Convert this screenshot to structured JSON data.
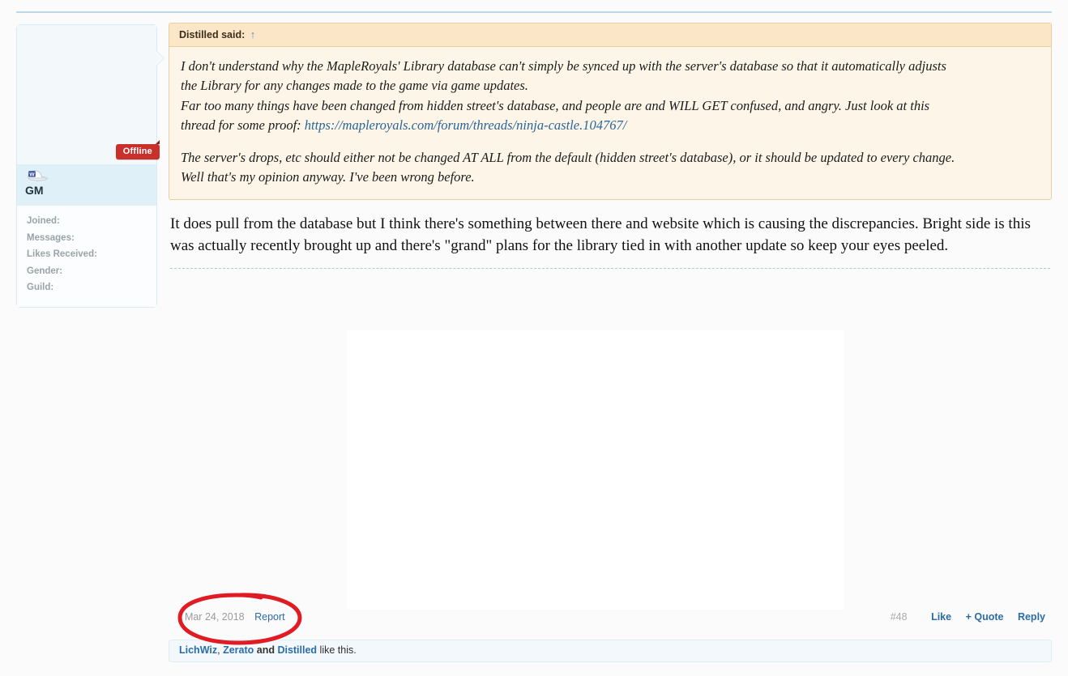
{
  "user_panel": {
    "status_badge": "Offline",
    "rank_icon": "gm-cap-icon",
    "title": "GM",
    "stats": [
      {
        "label": "Joined:",
        "value": ""
      },
      {
        "label": "Messages:",
        "value": ""
      },
      {
        "label": "Likes Received:",
        "value": ""
      },
      {
        "label": "Gender:",
        "value": ""
      },
      {
        "label": "Guild:",
        "value": ""
      }
    ]
  },
  "quote": {
    "header_text": "Distilled said:",
    "header_link_icon": "↑",
    "paragraph_1_line_1": "I don't understand why the MapleRoyals' Library database can't simply be synced up with the server's database so that it automatically adjusts",
    "paragraph_1_line_2": "the Library for any changes made to the game via game updates.",
    "paragraph_1_line_3": "Far too many things have been changed from hidden street's database, and people are and WILL GET confused, and angry. Just look at this",
    "paragraph_1_line_4_prefix": "thread for some proof: ",
    "paragraph_1_link": "https://mapleroyals.com/forum/threads/ninja-castle.104767/",
    "paragraph_2_line_1": "The server's drops, etc should either not be changed AT ALL from the default (hidden street's database), or it should be updated to every change.",
    "paragraph_2_line_2": "Well that's my opinion anyway. I've been wrong before."
  },
  "reply": {
    "text": "It does pull from the database but I think there's something between there and website which is causing the discrepancies. Bright side is this was actually recently brought up and there's \"grand\" plans for the library tied in with another update so keep your eyes peeled."
  },
  "footer": {
    "date": ", Mar 24, 2018",
    "report_label": "Report",
    "post_number": "#48",
    "like_label": "Like",
    "quote_label": "+ Quote",
    "reply_label": "Reply"
  },
  "likes": {
    "user_1": "LichWiz",
    "separator_1": ", ",
    "user_2": "Zerato",
    "separator_2": " and ",
    "user_3": "Distilled",
    "suffix": " like this."
  },
  "annotation": {
    "shape": "red-ellipse-highlight",
    "color": "#e01b24"
  },
  "colors": {
    "quote_bg": "#fdf6e8",
    "quote_header_bg": "#fbe7c8",
    "quote_border": "#e8cfa3",
    "panel_bg": "#f4f9fc",
    "badge_red": "#c9302c",
    "link_blue": "#2b6ca8",
    "page_bg": "#fbfbfc"
  }
}
